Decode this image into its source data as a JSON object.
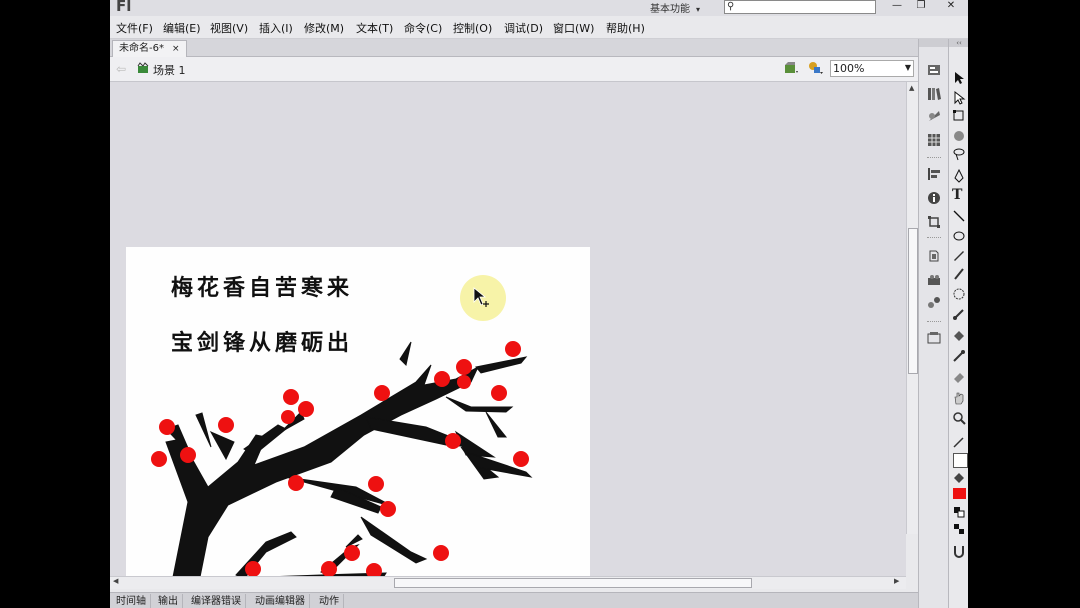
{
  "app": {
    "logo": "Fl"
  },
  "titlebar": {
    "workspace_label": "基本功能",
    "workspace_caret": "▾",
    "search_placeholder": "",
    "search_icon": "search-icon",
    "minimize": "—",
    "restore": "❐",
    "close": "✕"
  },
  "menu": {
    "items": [
      "文件(F)",
      "编辑(E)",
      "视图(V)",
      "插入(I)",
      "修改(M)",
      "文本(T)",
      "命令(C)",
      "控制(O)",
      "调试(D)",
      "窗口(W)",
      "帮助(H)"
    ]
  },
  "document_tab": {
    "label": "未命名-6*",
    "close": "×"
  },
  "editbar": {
    "scene_label": "场景 1",
    "zoom_value": "100%"
  },
  "stage": {
    "poem_line1": "梅花香自苦寒来",
    "poem_line2": "宝剑锋从磨砺出"
  },
  "bottom_tabs": [
    "时间轴",
    "输出",
    "编译器错误",
    "动画编辑器",
    "动作"
  ],
  "colors": {
    "blossom": "#ee1111",
    "branch": "#111111",
    "fill_color": "#ee1111",
    "stroke_color": "#555555",
    "highlight": "#f7f3a8"
  },
  "right_panel_icons": [
    "properties-icon",
    "library-icon",
    "color-icon",
    "swatches-icon",
    "align-icon",
    "info-icon",
    "transform-icon",
    "components-icon",
    "motion-presets-icon",
    "code-snippets-icon",
    "project-icon"
  ],
  "tools": [
    "selection-tool-icon",
    "subselection-tool-icon",
    "free-transform-tool-icon",
    "3d-rotation-tool-icon",
    "lasso-tool-icon",
    "pen-tool-icon",
    "text-tool-icon",
    "line-tool-icon",
    "rectangle-tool-icon",
    "pencil-tool-icon",
    "brush-tool-icon",
    "deco-tool-icon",
    "bone-tool-icon",
    "paint-bucket-tool-icon",
    "eyedropper-tool-icon",
    "eraser-tool-icon",
    "hand-tool-icon",
    "zoom-tool-icon",
    "stroke-color-icon",
    "fill-color-icon"
  ]
}
